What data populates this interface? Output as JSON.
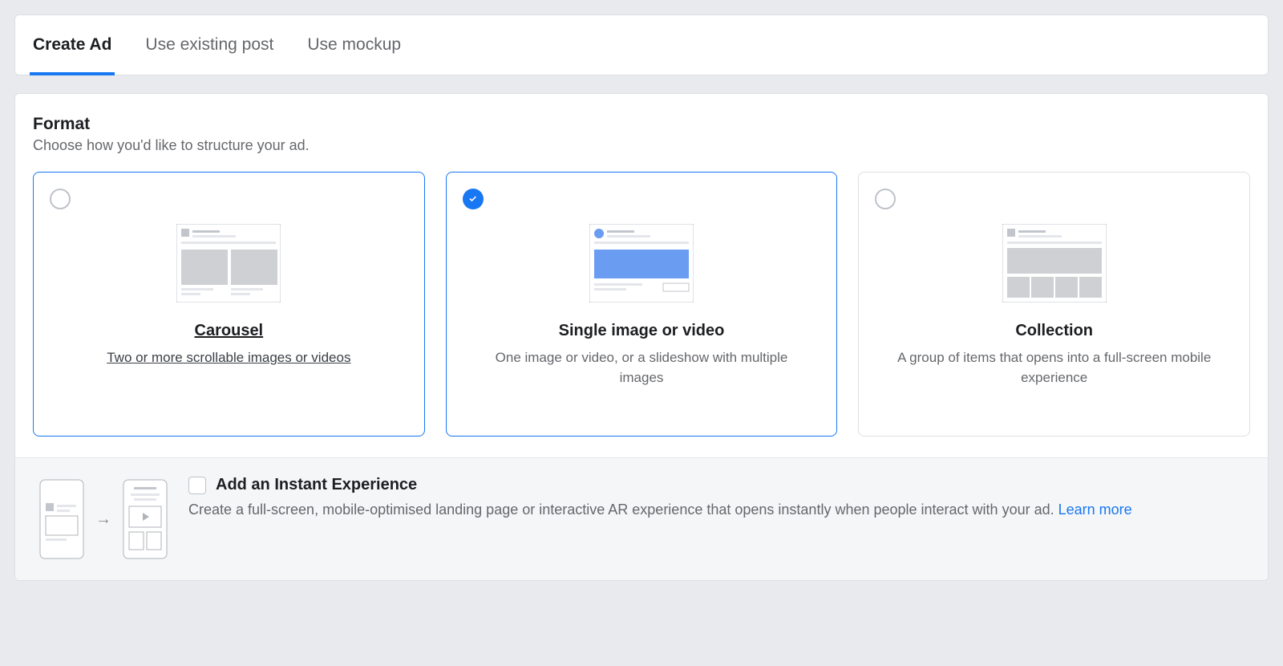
{
  "tabs": [
    {
      "label": "Create Ad",
      "active": true
    },
    {
      "label": "Use existing post",
      "active": false
    },
    {
      "label": "Use mockup",
      "active": false
    }
  ],
  "section": {
    "title": "Format",
    "subtitle": "Choose how you'd like to structure your ad."
  },
  "cards": {
    "carousel": {
      "title": "Carousel",
      "desc": "Two or more scrollable images or videos"
    },
    "single": {
      "title": "Single image or video",
      "desc": "One image or video, or a slideshow with multiple images"
    },
    "collection": {
      "title": "Collection",
      "desc": "A group of items that opens into a full-screen mobile experience"
    }
  },
  "instant_experience": {
    "title": "Add an Instant Experience",
    "desc": "Create a full-screen, mobile-optimised landing page or interactive AR experience that opens instantly when people interact with your ad. ",
    "learn_more": "Learn more"
  }
}
